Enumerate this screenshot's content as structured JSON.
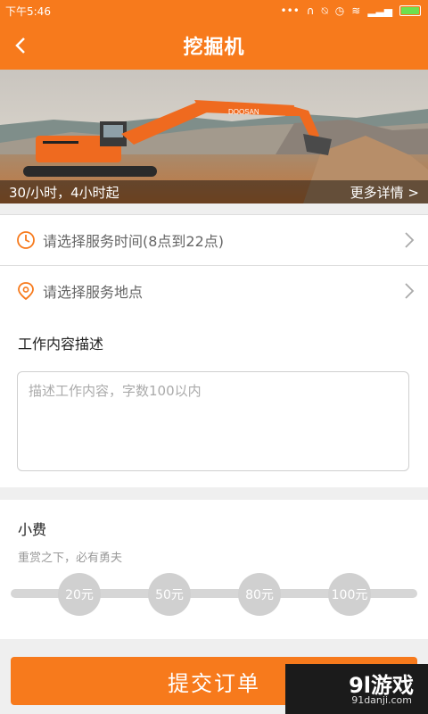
{
  "status": {
    "time": "下午5:46"
  },
  "nav": {
    "title": "挖掘机"
  },
  "banner": {
    "price": "30/小时，4小时起",
    "more": "更多详情 >",
    "brand": "DOOSAN"
  },
  "rows": [
    {
      "label": "请选择服务时间(8点到22点)"
    },
    {
      "label": "请选择服务地点"
    }
  ],
  "description": {
    "label": "工作内容描述",
    "placeholder": "描述工作内容，字数100以内"
  },
  "tip": {
    "label": "小费",
    "subtitle": "重赏之下，必有勇夫",
    "options": [
      "20元",
      "50元",
      "80元",
      "100元"
    ]
  },
  "submit": {
    "label": "提交订单"
  },
  "watermark": {
    "logo": "9l游戏",
    "url": "91danji.com"
  },
  "colors": {
    "accent": "#f77a1c"
  }
}
